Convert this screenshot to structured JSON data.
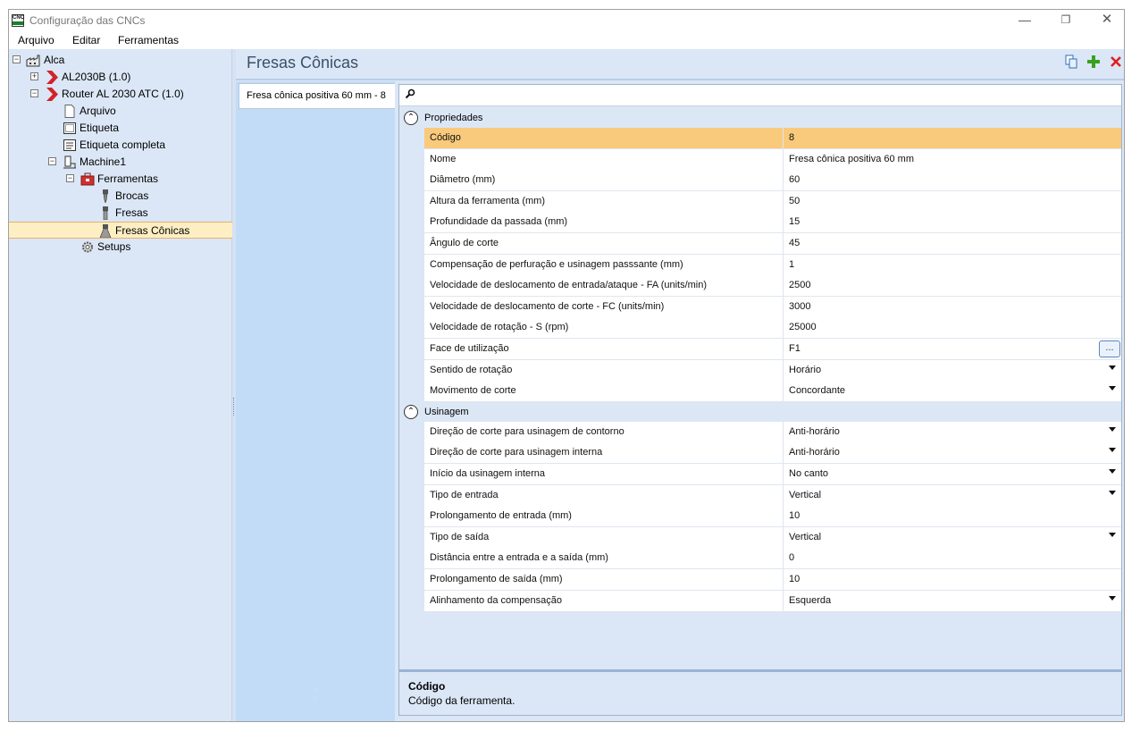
{
  "window": {
    "title": "Configuração das CNCs",
    "app_icon_text": "CNC"
  },
  "menu": [
    "Arquivo",
    "Editar",
    "Ferramentas"
  ],
  "tree": [
    {
      "label": "Alca",
      "icon": "factory-icon",
      "expander": "⊟"
    },
    {
      "label": "AL2030B (1.0)",
      "icon": "red-chevron-icon",
      "expander": "+"
    },
    {
      "label": "Router AL 2030 ATC (1.0)",
      "icon": "red-chevron-icon",
      "expander": "−"
    },
    {
      "label": "Arquivo",
      "icon": "file-icon"
    },
    {
      "label": "Etiqueta",
      "icon": "label-icon"
    },
    {
      "label": "Etiqueta completa",
      "icon": "label-complete-icon"
    },
    {
      "label": "Machine1",
      "icon": "machine-icon",
      "expander": "−"
    },
    {
      "label": "Ferramentas",
      "icon": "toolbox-icon",
      "expander": "−"
    },
    {
      "label": "Brocas",
      "icon": "drill-bit-icon"
    },
    {
      "label": "Fresas",
      "icon": "mill-icon"
    },
    {
      "label": "Fresas Cônicas",
      "icon": "conical-mill-icon",
      "selected": true
    },
    {
      "label": "Setups",
      "icon": "gear-icon"
    }
  ],
  "page": {
    "title": "Fresas Cônicas"
  },
  "toolbar": {
    "copy_icon": "copy-icon",
    "add_icon": "add-icon",
    "delete_icon": "delete-icon",
    "accent_add": "#3aa020",
    "accent_delete": "#e02020"
  },
  "list": {
    "items": [
      "Fresa cônica positiva 60 mm - 8"
    ]
  },
  "grid": {
    "categories": [
      {
        "label": "Propriedades",
        "rows": [
          {
            "name": "Código",
            "value": "8",
            "selected": true
          },
          {
            "name": "Nome",
            "value": "Fresa cônica positiva 60 mm"
          },
          {
            "name": "Diâmetro (mm)",
            "value": "60"
          },
          {
            "name": "Altura da ferramenta (mm)",
            "value": "50"
          },
          {
            "name": "Profundidade da passada (mm)",
            "value": "15"
          },
          {
            "name": "Ângulo de corte",
            "value": "45"
          },
          {
            "name": "Compensação de perfuração e usinagem passsante (mm)",
            "value": "1"
          },
          {
            "name": "Velocidade de deslocamento de entrada/ataque - FA (units/min)",
            "value": "2500"
          },
          {
            "name": "Velocidade de deslocamento de corte - FC (units/min)",
            "value": "3000"
          },
          {
            "name": "Velocidade de rotação - S (rpm)",
            "value": "25000"
          },
          {
            "name": "Face de utilização",
            "value": "F1",
            "button": "..."
          },
          {
            "name": "Sentido de rotação",
            "value": "Horário",
            "dropdown": true
          },
          {
            "name": "Movimento de corte",
            "value": "Concordante",
            "dropdown": true
          }
        ]
      },
      {
        "label": "Usinagem",
        "rows": [
          {
            "name": "Direção de corte para usinagem de contorno",
            "value": "Anti-horário",
            "dropdown": true
          },
          {
            "name": "Direção de corte para usinagem interna",
            "value": "Anti-horário",
            "dropdown": true
          },
          {
            "name": "Início da usinagem interna",
            "value": "No canto",
            "dropdown": true
          },
          {
            "name": "Tipo de entrada",
            "value": "Vertical",
            "dropdown": true
          },
          {
            "name": "Prolongamento de entrada (mm)",
            "value": "10"
          },
          {
            "name": "Tipo de saída",
            "value": "Vertical",
            "dropdown": true
          },
          {
            "name": "Distância entre a entrada e a saída (mm)",
            "value": "0"
          },
          {
            "name": "Prolongamento de saída (mm)",
            "value": "10"
          },
          {
            "name": "Alinhamento da compensação",
            "value": "Esquerda",
            "dropdown": true
          }
        ]
      }
    ]
  },
  "description": {
    "title": "Código",
    "text": "Código da ferramenta."
  }
}
